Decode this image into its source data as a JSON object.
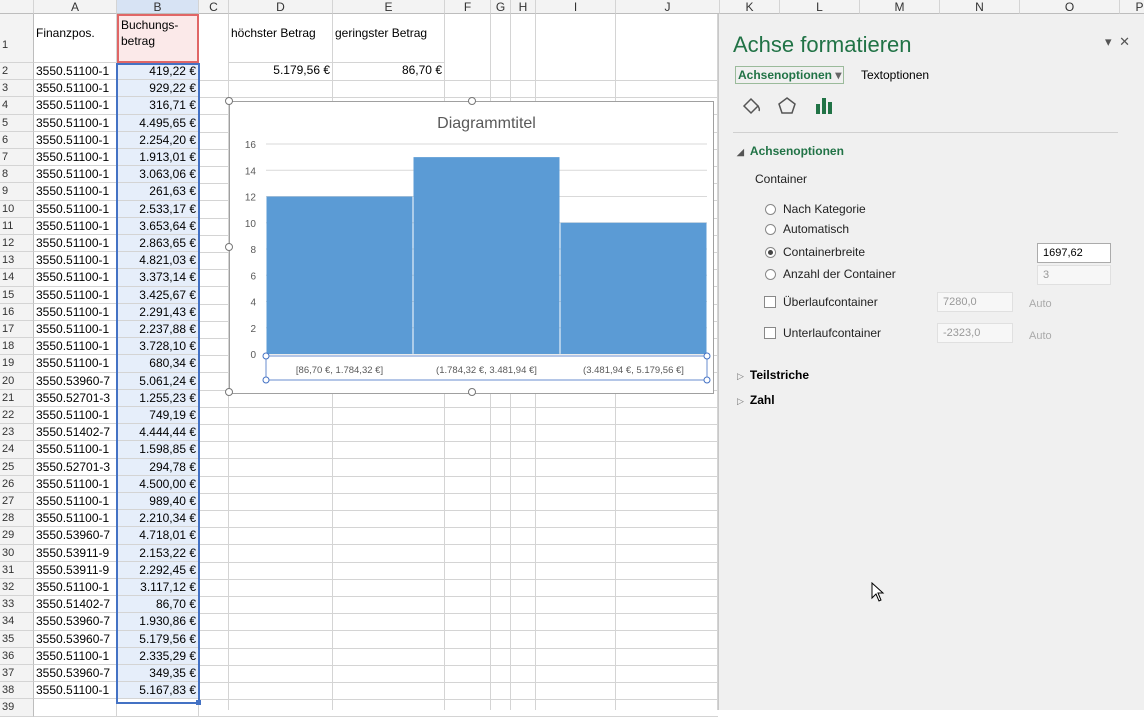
{
  "sheet": {
    "columns": [
      "A",
      "B",
      "C",
      "D",
      "E",
      "F",
      "G",
      "H",
      "I",
      "J",
      "K",
      "L",
      "M",
      "N",
      "O",
      "P"
    ],
    "row1": {
      "a": "Finanzpos.",
      "b1": "Buchungs-",
      "b2": "betrag",
      "d": "höchster Betrag",
      "e": "geringster Betrag",
      "row": "1"
    },
    "row2": {
      "d": "5.179,56 €",
      "e": "86,70 €"
    },
    "rows": [
      {
        "n": "2",
        "a": "3550.51100-1",
        "b": "419,22 €"
      },
      {
        "n": "3",
        "a": "3550.51100-1",
        "b": "929,22 €"
      },
      {
        "n": "4",
        "a": "3550.51100-1",
        "b": "316,71 €"
      },
      {
        "n": "5",
        "a": "3550.51100-1",
        "b": "4.495,65 €"
      },
      {
        "n": "6",
        "a": "3550.51100-1",
        "b": "2.254,20 €"
      },
      {
        "n": "7",
        "a": "3550.51100-1",
        "b": "1.913,01 €"
      },
      {
        "n": "8",
        "a": "3550.51100-1",
        "b": "3.063,06 €"
      },
      {
        "n": "9",
        "a": "3550.51100-1",
        "b": "261,63 €"
      },
      {
        "n": "10",
        "a": "3550.51100-1",
        "b": "2.533,17 €"
      },
      {
        "n": "11",
        "a": "3550.51100-1",
        "b": "3.653,64 €"
      },
      {
        "n": "12",
        "a": "3550.51100-1",
        "b": "2.863,65 €"
      },
      {
        "n": "13",
        "a": "3550.51100-1",
        "b": "4.821,03 €"
      },
      {
        "n": "14",
        "a": "3550.51100-1",
        "b": "3.373,14 €"
      },
      {
        "n": "15",
        "a": "3550.51100-1",
        "b": "3.425,67 €"
      },
      {
        "n": "16",
        "a": "3550.51100-1",
        "b": "2.291,43 €"
      },
      {
        "n": "17",
        "a": "3550.51100-1",
        "b": "2.237,88 €"
      },
      {
        "n": "18",
        "a": "3550.51100-1",
        "b": "3.728,10 €"
      },
      {
        "n": "19",
        "a": "3550.51100-1",
        "b": "680,34 €"
      },
      {
        "n": "20",
        "a": "3550.53960-7",
        "b": "5.061,24 €"
      },
      {
        "n": "21",
        "a": "3550.52701-3",
        "b": "1.255,23 €"
      },
      {
        "n": "22",
        "a": "3550.51100-1",
        "b": "749,19 €"
      },
      {
        "n": "23",
        "a": "3550.51402-7",
        "b": "4.444,44 €"
      },
      {
        "n": "24",
        "a": "3550.51100-1",
        "b": "1.598,85 €"
      },
      {
        "n": "25",
        "a": "3550.52701-3",
        "b": "294,78 €"
      },
      {
        "n": "26",
        "a": "3550.51100-1",
        "b": "4.500,00 €"
      },
      {
        "n": "27",
        "a": "3550.51100-1",
        "b": "989,40 €"
      },
      {
        "n": "28",
        "a": "3550.51100-1",
        "b": "2.210,34 €"
      },
      {
        "n": "29",
        "a": "3550.53960-7",
        "b": "4.718,01 €"
      },
      {
        "n": "30",
        "a": "3550.53911-9",
        "b": "2.153,22 €"
      },
      {
        "n": "31",
        "a": "3550.53911-9",
        "b": "2.292,45 €"
      },
      {
        "n": "32",
        "a": "3550.51100-1",
        "b": "3.117,12 €"
      },
      {
        "n": "33",
        "a": "3550.51402-7",
        "b": "86,70 €"
      },
      {
        "n": "34",
        "a": "3550.53960-7",
        "b": "1.930,86 €"
      },
      {
        "n": "35",
        "a": "3550.53960-7",
        "b": "5.179,56 €"
      },
      {
        "n": "36",
        "a": "3550.51100-1",
        "b": "2.335,29 €"
      },
      {
        "n": "37",
        "a": "3550.53960-7",
        "b": "349,35 €"
      },
      {
        "n": "38",
        "a": "3550.51100-1",
        "b": "5.167,83 €"
      },
      {
        "n": "39",
        "a": "",
        "b": ""
      }
    ]
  },
  "chart_data": {
    "type": "bar",
    "title": "Diagrammtitel",
    "categories": [
      "[86,70 €, 1.784,32 €]",
      "(1.784,32 €, 3.481,94 €]",
      "(3.481,94 €, 5.179,56 €]"
    ],
    "values": [
      12,
      15,
      10
    ],
    "ylim": [
      0,
      16
    ],
    "yticks": [
      "0",
      "2",
      "4",
      "6",
      "8",
      "10",
      "12",
      "14",
      "16"
    ],
    "bar_color": "#5b9bd5",
    "grid": true
  },
  "panel": {
    "title": "Achse formatieren",
    "close": "✕",
    "dropdown": "▾",
    "tab_active": "Achsenoptionen",
    "tab_other": "Textoptionen",
    "section_axis": "Achsenoptionen",
    "container_label": "Container",
    "opt_category": "Nach Kategorie",
    "opt_auto": "Automatisch",
    "opt_width": "Containerbreite",
    "opt_count": "Anzahl der Container",
    "width_value": "1697,62",
    "count_value": "3",
    "overflow_label": "Überlaufcontainer",
    "overflow_value": "7280,0",
    "underflow_label": "Unterlaufcontainer",
    "underflow_value": "-2323,0",
    "auto1": "Auto",
    "auto2": "Auto",
    "section_ticks": "Teilstriche",
    "section_number": "Zahl",
    "accent": "#217346"
  }
}
